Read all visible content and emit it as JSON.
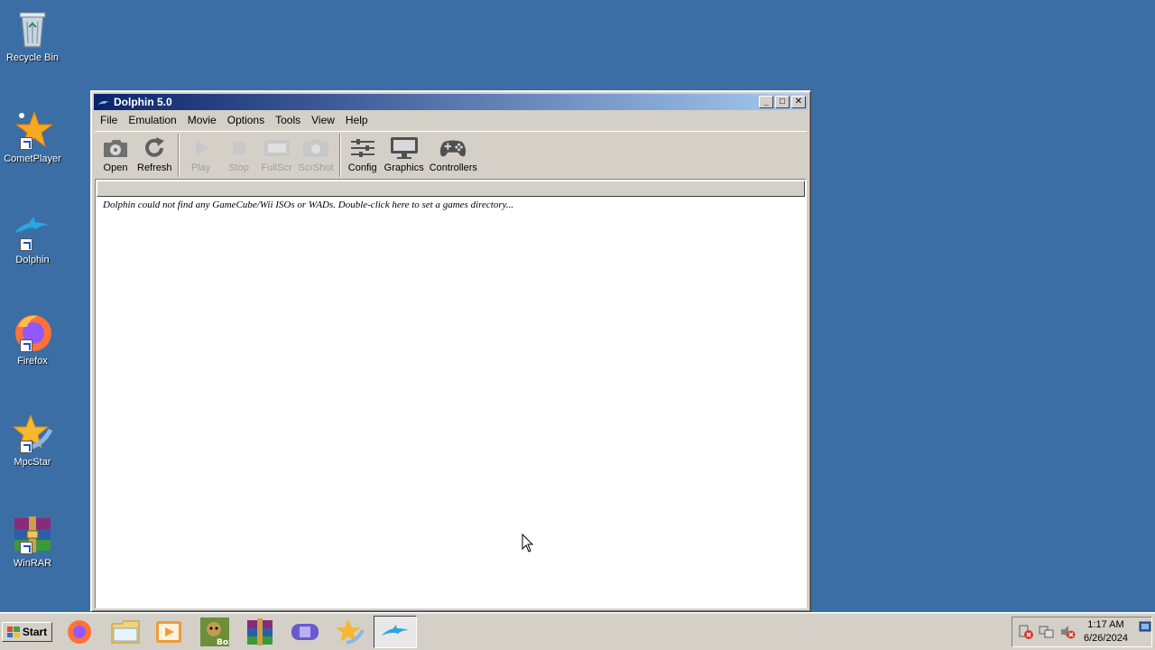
{
  "desktop": {
    "icons": [
      {
        "label": "Recycle Bin",
        "icon": "recycle-bin-icon"
      },
      {
        "label": "CometPlayer",
        "icon": "cometplayer-icon"
      },
      {
        "label": "Dolphin",
        "icon": "dolphin-icon"
      },
      {
        "label": "Firefox",
        "icon": "firefox-icon"
      },
      {
        "label": "MpcStar",
        "icon": "mpcstar-icon"
      },
      {
        "label": "WinRAR",
        "icon": "winrar-icon"
      }
    ],
    "background_color": "#3a6ea5"
  },
  "window": {
    "title": "Dolphin 5.0",
    "buttons": {
      "minimize": "_",
      "maximize": "□",
      "close": "✕"
    },
    "menu": [
      "File",
      "Emulation",
      "Movie",
      "Options",
      "Tools",
      "View",
      "Help"
    ],
    "toolbar": [
      {
        "label": "Open",
        "icon": "open-disc-icon",
        "enabled": true
      },
      {
        "label": "Refresh",
        "icon": "refresh-icon",
        "enabled": true
      },
      {
        "label": "Play",
        "icon": "play-icon",
        "enabled": false
      },
      {
        "label": "Stop",
        "icon": "stop-icon",
        "enabled": false
      },
      {
        "label": "FullScr",
        "icon": "fullscreen-icon",
        "enabled": false
      },
      {
        "label": "ScrShot",
        "icon": "screenshot-icon",
        "enabled": false
      },
      {
        "label": "Config",
        "icon": "config-sliders-icon",
        "enabled": true
      },
      {
        "label": "Graphics",
        "icon": "monitor-icon",
        "enabled": true
      },
      {
        "label": "Controllers",
        "icon": "gamepad-icon",
        "enabled": true
      }
    ],
    "game_list_message": "Dolphin could not find any GameCube/Wii ISOs or WADs. Double-click here to set a games directory..."
  },
  "taskbar": {
    "start_label": "Start",
    "quick_launch": [
      {
        "icon": "firefox-icon"
      },
      {
        "icon": "file-explorer-icon"
      },
      {
        "icon": "media-player-icon"
      },
      {
        "icon": "box-game-icon",
        "label": "Box"
      },
      {
        "icon": "winrar-icon"
      },
      {
        "icon": "gba-emulator-icon"
      },
      {
        "icon": "mpcstar-icon"
      },
      {
        "icon": "dolphin-icon",
        "active": true
      }
    ],
    "tray": {
      "icons": [
        "network-error-icon",
        "network-icon",
        "volume-muted-icon"
      ],
      "time": "1:17 AM",
      "date": "6/26/2024"
    }
  }
}
